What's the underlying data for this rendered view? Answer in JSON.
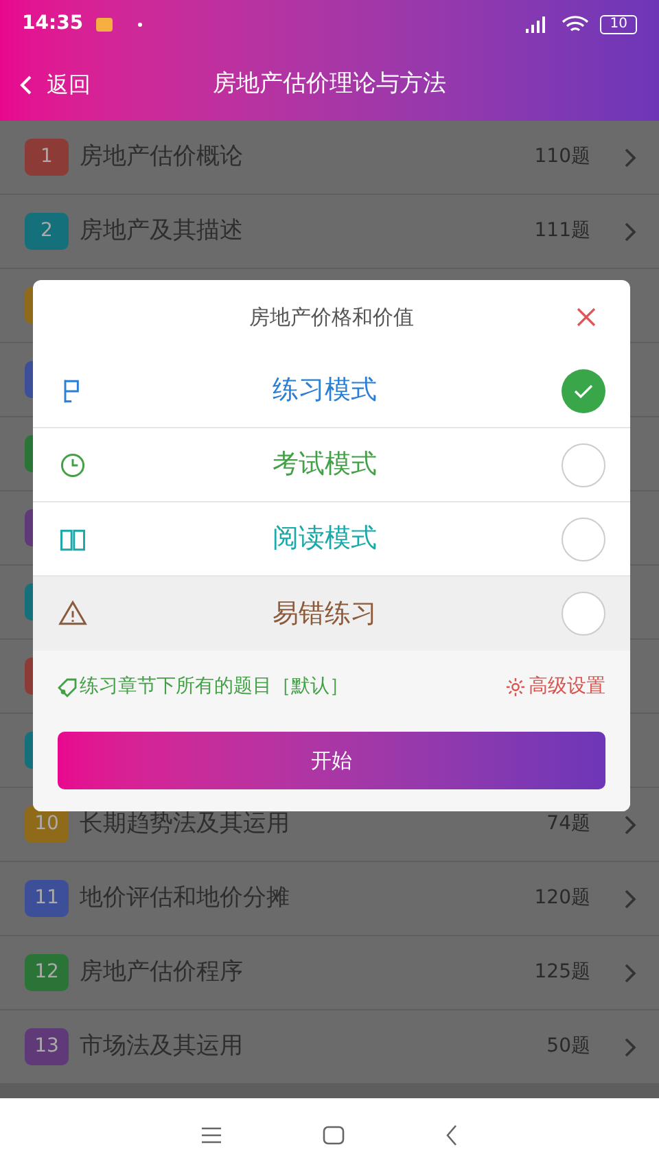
{
  "status_bar": {
    "time": "14:35",
    "battery": "10"
  },
  "header": {
    "back": "返回",
    "title": "房地产估价理论与方法"
  },
  "chapters": [
    {
      "number": "1",
      "title": "房地产估价概论",
      "count": "110题",
      "color": "#8c3b37"
    },
    {
      "number": "2",
      "title": "房地产及其描述",
      "count": "111题",
      "color": "#14707a"
    },
    {
      "color": "#8f6a18"
    },
    {
      "color": "#3d4f99"
    },
    {
      "color": "#2b7437"
    },
    {
      "color": "#603a78"
    },
    {
      "color": "#14707a"
    },
    {
      "color": "#8c3b37"
    },
    {
      "color": "#14707a"
    },
    {
      "number": "10",
      "title": "长期趋势法及其运用",
      "count": "74题",
      "color": "#8f6a18"
    },
    {
      "number": "11",
      "title": "地价评估和地价分摊",
      "count": "120题",
      "color": "#3d4f99"
    },
    {
      "number": "12",
      "title": "房地产估价程序",
      "count": "125题",
      "color": "#2b7437"
    },
    {
      "number": "13",
      "title": "市场法及其运用",
      "count": "50题",
      "color": "#603a78"
    }
  ],
  "dialog": {
    "title": "房地产价格和价值",
    "modes": [
      {
        "kind": "flag",
        "label": "练习模式",
        "color": "#2a7fd4",
        "selected": true,
        "highlighted": false
      },
      {
        "kind": "clock",
        "label": "考试模式",
        "color": "#43a047",
        "selected": false,
        "highlighted": false
      },
      {
        "kind": "book",
        "label": "阅读模式",
        "color": "#1aa8a8",
        "selected": false,
        "highlighted": false
      },
      {
        "kind": "warning",
        "label": "易错练习",
        "color": "#8a5a3a",
        "selected": false,
        "highlighted": true
      }
    ],
    "scope": "练习章节下所有的题目［默认］",
    "settings": "高级设置",
    "start": "开始"
  }
}
